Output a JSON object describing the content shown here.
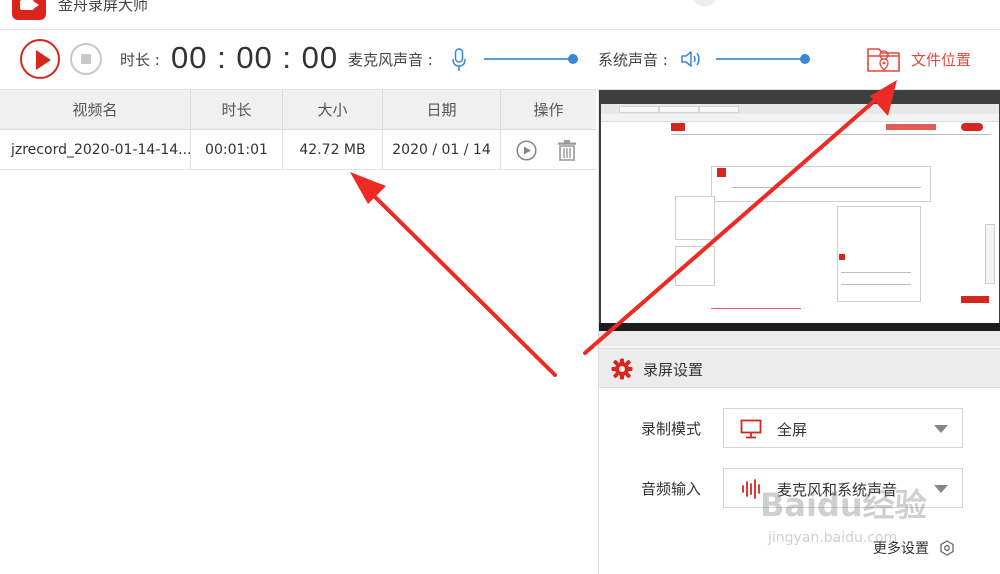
{
  "app": {
    "title": "金舟录屏大师"
  },
  "toolbar": {
    "duration_label": "时长 :",
    "timer": "00 : 00 : 00",
    "mic_label": "麦克风声音 :",
    "mic_level": 1.0,
    "system_label": "系统声音 :",
    "system_level": 1.0,
    "file_location_label": "文件位置",
    "accent_color": "#d9261c"
  },
  "table": {
    "columns": [
      "视频名",
      "时长",
      "大小",
      "日期",
      "操作"
    ],
    "rows": [
      {
        "name": "jzrecord_2020-01-14-14...",
        "duration": "00:01:01",
        "size": "42.72 MB",
        "date": "2020 / 01 / 14"
      }
    ]
  },
  "settings": {
    "title": "录屏设置",
    "record_mode_label": "录制模式",
    "record_mode_value": "全屏",
    "audio_input_label": "音频输入",
    "audio_input_value": "麦克风和系统声音",
    "more_settings_label": "更多设置"
  },
  "watermark": {
    "brand": "Baidu经验",
    "url": "jingyan.baidu.com"
  },
  "icons": [
    "record-icon",
    "stop-icon",
    "microphone-icon",
    "speaker-icon",
    "folder-location-icon",
    "play-icon",
    "trash-icon",
    "gear-icon",
    "monitor-icon",
    "audio-wave-icon",
    "settings-ring-icon"
  ]
}
